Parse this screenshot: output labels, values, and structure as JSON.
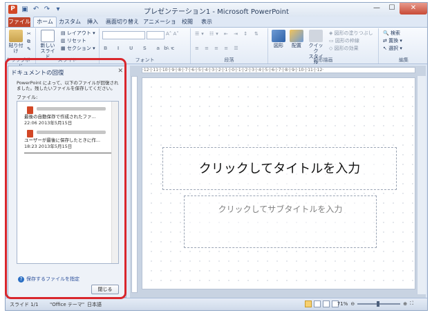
{
  "window": {
    "title": "プレゼンテーション1 - Microsoft PowerPoint",
    "app_icon": "P",
    "close": "✕",
    "minimize": "—",
    "maximize": "☐"
  },
  "qat": [
    "save-icon",
    "undo-icon",
    "redo-icon",
    "customize-icon"
  ],
  "tabs": [
    "ファイル",
    "ホーム",
    "カスタム",
    "挿入",
    "画面切り替え",
    "アニメーション",
    "校閲",
    "表示"
  ],
  "ribbon": {
    "paste": "貼り付け",
    "new_slide_l1": "新しい",
    "new_slide_l2": "スライド",
    "layout": "レイアウト",
    "reset": "リセット",
    "section": "セクション",
    "shape": "図形",
    "arrange": "配置",
    "quick_style_l1": "クイック",
    "quick_style_l2": "スタイル",
    "shape_fill": "図形の塗りつぶし",
    "shape_outline": "図形の枠線",
    "shape_effects": "図形の効果",
    "find": "検索",
    "replace": "置換",
    "select": "選択",
    "group_clipboard": "クリップボード",
    "group_slides": "スライド",
    "group_font": "フォント",
    "group_paragraph": "段落",
    "group_drawing": "図形描画",
    "group_editing": "編集"
  },
  "recovery": {
    "title": "ドキュメントの回復",
    "description": "PowerPoint によって、以下のファイルが回復されました。残したいファイルを保存してください。",
    "files_label": "ファイル:",
    "files": [
      {
        "name": "最後の自動保存で作成されたファ...",
        "time": "22:06 2013年5月15日"
      },
      {
        "name": "ユーザーが最後に保存したときに作...",
        "time": "18:23 2013年5月15日"
      }
    ],
    "help_link": "保存するファイルを指定",
    "close_button": "閉じる"
  },
  "slide": {
    "title_placeholder": "クリックしてタイトルを入力",
    "subtitle_placeholder": "クリックしてサブタイトルを入力"
  },
  "ruler_text": "·12·|·11·|·10·|·9·|·8·|·7·|·6·|·5·|·4·|·3·|·2·|·1·|·0·|·1·|·2·|·3·|·4·|·5·|·6·|·7·|·8·|·9·|·10·|·11·|·12·",
  "status": {
    "slide": "スライド 1/1",
    "theme": "\"Office テーマ\"",
    "language": "日本語",
    "zoom": "71%"
  },
  "colors": {
    "accent_red": "#d9262c",
    "file_tab": "#c0442a"
  }
}
